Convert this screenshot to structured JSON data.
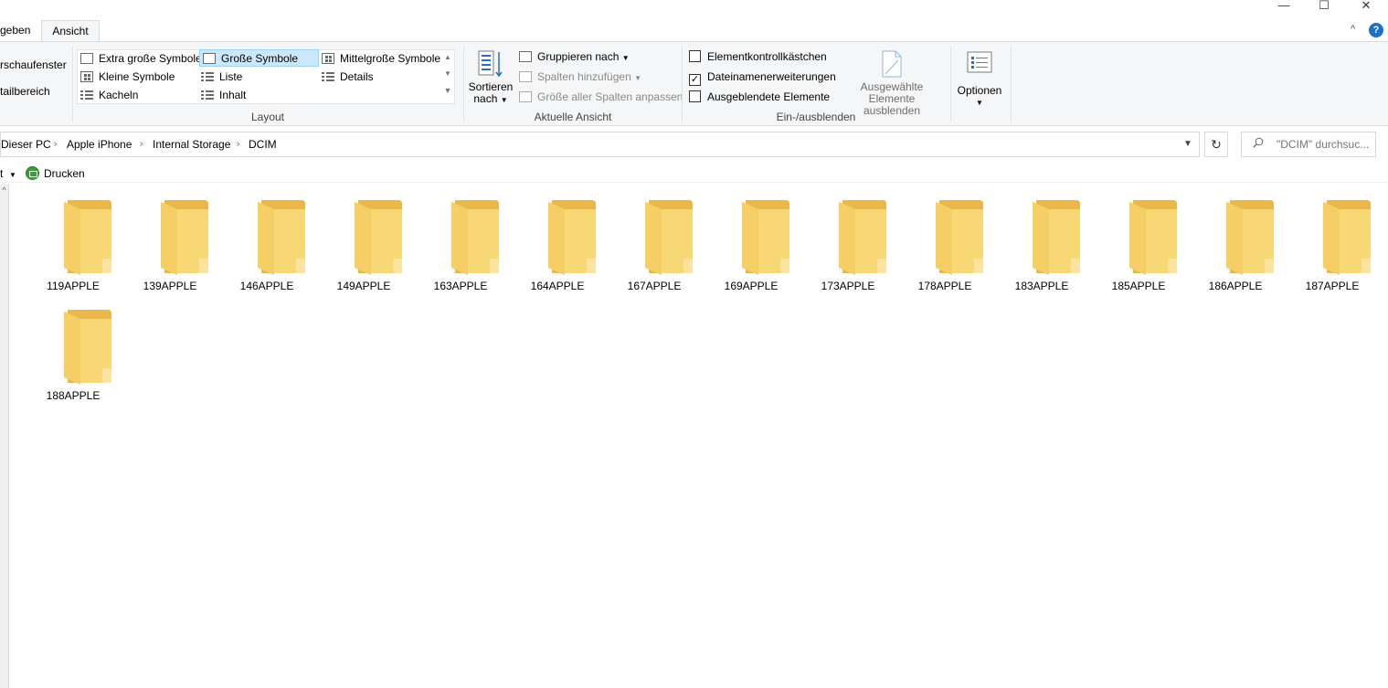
{
  "tabs": {
    "share_partial": "geben",
    "view": "Ansicht"
  },
  "window": {
    "minimize": "—",
    "maximize": "☐",
    "close": "✕",
    "help": "?",
    "collapse": "^"
  },
  "ribbon": {
    "panes": {
      "preview_partial": "rschaufenster",
      "details_partial": "tailbereich"
    },
    "layout": {
      "label": "Layout",
      "options": [
        "Extra große Symbole",
        "Große Symbole",
        "Mittelgroße Symbole",
        "Kleine Symbole",
        "Liste",
        "Details",
        "Kacheln",
        "Inhalt"
      ],
      "selected": "Große Symbole"
    },
    "current_view": {
      "label": "Aktuelle Ansicht",
      "sort_line1": "Sortieren",
      "sort_line2": "nach",
      "group": "Gruppieren nach",
      "add_columns": "Spalten hinzufügen",
      "fit_columns": "Größe aller Spalten anpassen"
    },
    "show_hide": {
      "label": "Ein-/ausblenden",
      "item_checkboxes": "Elementkontrollkästchen",
      "item_checkboxes_checked": false,
      "file_extensions": "Dateinamenerweiterungen",
      "file_extensions_checked": true,
      "hidden_items": "Ausgeblendete Elemente",
      "hidden_items_checked": false,
      "hide_selected_line1": "Ausgewählte",
      "hide_selected_line2": "Elemente ausblenden"
    },
    "options": {
      "label": "Optionen"
    }
  },
  "address": {
    "crumbs": [
      "Dieser PC",
      "Apple iPhone",
      "Internal Storage",
      "DCIM"
    ]
  },
  "search": {
    "placeholder": "\"DCIM\" durchsuc..."
  },
  "command_bar": {
    "partial": "t",
    "print": "Drucken"
  },
  "folders": [
    "119APPLE",
    "139APPLE",
    "146APPLE",
    "149APPLE",
    "163APPLE",
    "164APPLE",
    "167APPLE",
    "169APPLE",
    "173APPLE",
    "178APPLE",
    "183APPLE",
    "185APPLE",
    "186APPLE",
    "187APPLE",
    "188APPLE"
  ],
  "colors": {
    "folder_front": "#f8d775",
    "folder_back": "#e8b84a",
    "selection": "#cce8ff",
    "accent": "#1f6fc6"
  }
}
